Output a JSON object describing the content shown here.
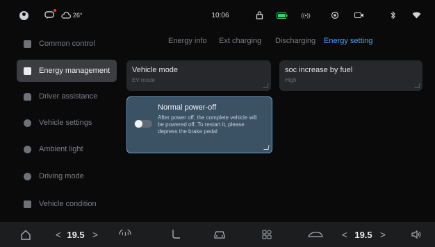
{
  "status_bar": {
    "temperature": "26°",
    "time": "10:06"
  },
  "sidebar": {
    "items": [
      {
        "label": "Common control"
      },
      {
        "label": "Energy management"
      },
      {
        "label": "Driver assistance"
      },
      {
        "label": "Vehicle settings"
      },
      {
        "label": "Ambient light"
      },
      {
        "label": "Driving mode"
      },
      {
        "label": "Vehicle condition"
      }
    ],
    "active_index": 1
  },
  "tabs": [
    {
      "label": "Energy info"
    },
    {
      "label": "Ext charging"
    },
    {
      "label": "Discharging"
    },
    {
      "label": "Energy setting"
    }
  ],
  "cards": {
    "vehicle_mode": {
      "title": "Vehicle mode",
      "value": "EV mode"
    },
    "soc_increase": {
      "title": "soc increase by fuel",
      "value": "High"
    }
  },
  "popup": {
    "title": "Normal power-off",
    "description": "After power off, the complete vehicle will be powered off. To restart it, please depress the brake pedal",
    "toggle_on": false
  },
  "bottom_bar": {
    "left_temp": "19.5",
    "right_temp": "19.5",
    "chev_left": "<",
    "chev_right": ">"
  },
  "colors": {
    "accent": "#4aa3ff",
    "popup_bg": "#3b5265"
  }
}
